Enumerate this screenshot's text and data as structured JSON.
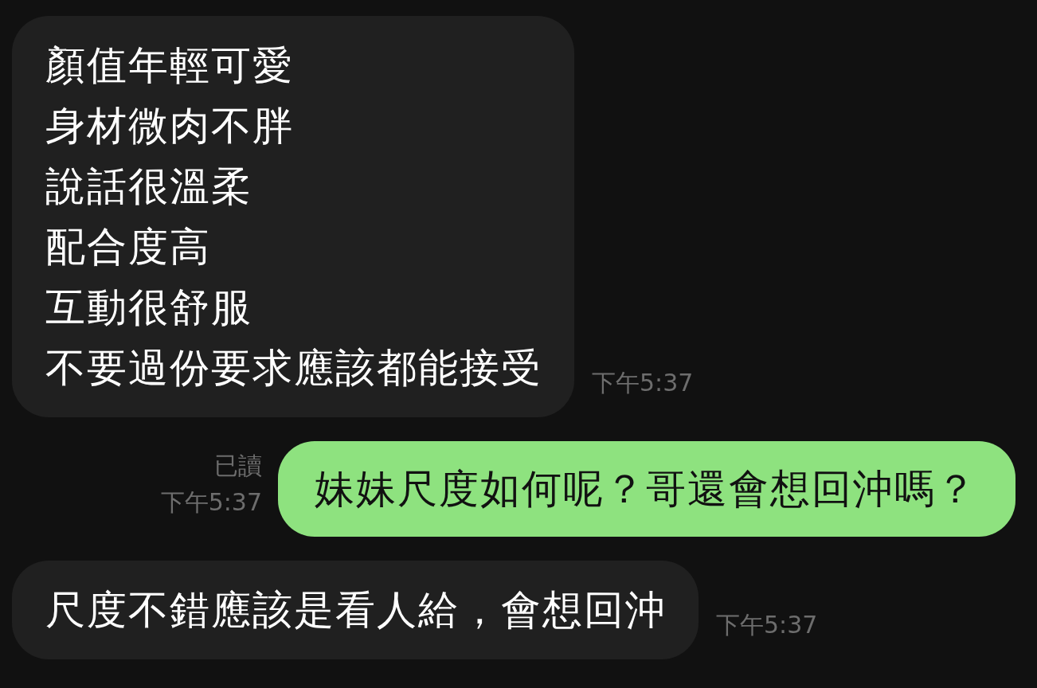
{
  "messages": [
    {
      "kind": "received",
      "lines": [
        "顏值年輕可愛",
        "身材微肉不胖",
        "說話很溫柔",
        "配合度高",
        "互動很舒服",
        "不要過份要求應該都能接受"
      ],
      "time": "下午5:37"
    },
    {
      "kind": "sent",
      "lines": [
        "妹妹尺度如何呢？哥還會想回沖嗎？"
      ],
      "read": "已讀",
      "time": "下午5:37"
    },
    {
      "kind": "received",
      "lines": [
        "尺度不錯應該是看人給，會想回沖"
      ],
      "time": "下午5:37"
    }
  ]
}
